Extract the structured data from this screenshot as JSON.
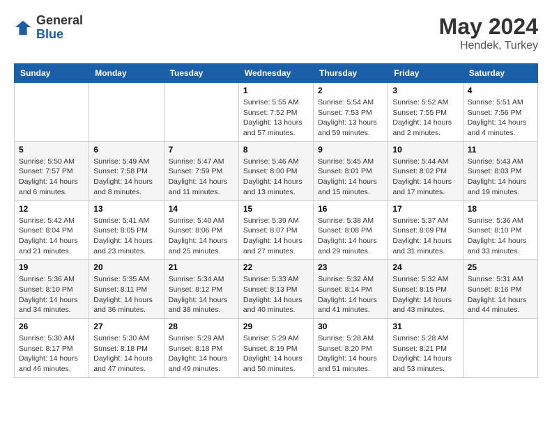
{
  "logo": {
    "general": "General",
    "blue": "Blue"
  },
  "title": {
    "month_year": "May 2024",
    "location": "Hendek, Turkey"
  },
  "days_of_week": [
    "Sunday",
    "Monday",
    "Tuesday",
    "Wednesday",
    "Thursday",
    "Friday",
    "Saturday"
  ],
  "weeks": [
    [
      {
        "day": "",
        "info": ""
      },
      {
        "day": "",
        "info": ""
      },
      {
        "day": "",
        "info": ""
      },
      {
        "day": "1",
        "info": "Sunrise: 5:55 AM\nSunset: 7:52 PM\nDaylight: 13 hours\nand 57 minutes."
      },
      {
        "day": "2",
        "info": "Sunrise: 5:54 AM\nSunset: 7:53 PM\nDaylight: 13 hours\nand 59 minutes."
      },
      {
        "day": "3",
        "info": "Sunrise: 5:52 AM\nSunset: 7:55 PM\nDaylight: 14 hours\nand 2 minutes."
      },
      {
        "day": "4",
        "info": "Sunrise: 5:51 AM\nSunset: 7:56 PM\nDaylight: 14 hours\nand 4 minutes."
      }
    ],
    [
      {
        "day": "5",
        "info": "Sunrise: 5:50 AM\nSunset: 7:57 PM\nDaylight: 14 hours\nand 6 minutes."
      },
      {
        "day": "6",
        "info": "Sunrise: 5:49 AM\nSunset: 7:58 PM\nDaylight: 14 hours\nand 8 minutes."
      },
      {
        "day": "7",
        "info": "Sunrise: 5:47 AM\nSunset: 7:59 PM\nDaylight: 14 hours\nand 11 minutes."
      },
      {
        "day": "8",
        "info": "Sunrise: 5:46 AM\nSunset: 8:00 PM\nDaylight: 14 hours\nand 13 minutes."
      },
      {
        "day": "9",
        "info": "Sunrise: 5:45 AM\nSunset: 8:01 PM\nDaylight: 14 hours\nand 15 minutes."
      },
      {
        "day": "10",
        "info": "Sunrise: 5:44 AM\nSunset: 8:02 PM\nDaylight: 14 hours\nand 17 minutes."
      },
      {
        "day": "11",
        "info": "Sunrise: 5:43 AM\nSunset: 8:03 PM\nDaylight: 14 hours\nand 19 minutes."
      }
    ],
    [
      {
        "day": "12",
        "info": "Sunrise: 5:42 AM\nSunset: 8:04 PM\nDaylight: 14 hours\nand 21 minutes."
      },
      {
        "day": "13",
        "info": "Sunrise: 5:41 AM\nSunset: 8:05 PM\nDaylight: 14 hours\nand 23 minutes."
      },
      {
        "day": "14",
        "info": "Sunrise: 5:40 AM\nSunset: 8:06 PM\nDaylight: 14 hours\nand 25 minutes."
      },
      {
        "day": "15",
        "info": "Sunrise: 5:39 AM\nSunset: 8:07 PM\nDaylight: 14 hours\nand 27 minutes."
      },
      {
        "day": "16",
        "info": "Sunrise: 5:38 AM\nSunset: 8:08 PM\nDaylight: 14 hours\nand 29 minutes."
      },
      {
        "day": "17",
        "info": "Sunrise: 5:37 AM\nSunset: 8:09 PM\nDaylight: 14 hours\nand 31 minutes."
      },
      {
        "day": "18",
        "info": "Sunrise: 5:36 AM\nSunset: 8:10 PM\nDaylight: 14 hours\nand 33 minutes."
      }
    ],
    [
      {
        "day": "19",
        "info": "Sunrise: 5:36 AM\nSunset: 8:10 PM\nDaylight: 14 hours\nand 34 minutes."
      },
      {
        "day": "20",
        "info": "Sunrise: 5:35 AM\nSunset: 8:11 PM\nDaylight: 14 hours\nand 36 minutes."
      },
      {
        "day": "21",
        "info": "Sunrise: 5:34 AM\nSunset: 8:12 PM\nDaylight: 14 hours\nand 38 minutes."
      },
      {
        "day": "22",
        "info": "Sunrise: 5:33 AM\nSunset: 8:13 PM\nDaylight: 14 hours\nand 40 minutes."
      },
      {
        "day": "23",
        "info": "Sunrise: 5:32 AM\nSunset: 8:14 PM\nDaylight: 14 hours\nand 41 minutes."
      },
      {
        "day": "24",
        "info": "Sunrise: 5:32 AM\nSunset: 8:15 PM\nDaylight: 14 hours\nand 43 minutes."
      },
      {
        "day": "25",
        "info": "Sunrise: 5:31 AM\nSunset: 8:16 PM\nDaylight: 14 hours\nand 44 minutes."
      }
    ],
    [
      {
        "day": "26",
        "info": "Sunrise: 5:30 AM\nSunset: 8:17 PM\nDaylight: 14 hours\nand 46 minutes."
      },
      {
        "day": "27",
        "info": "Sunrise: 5:30 AM\nSunset: 8:18 PM\nDaylight: 14 hours\nand 47 minutes."
      },
      {
        "day": "28",
        "info": "Sunrise: 5:29 AM\nSunset: 8:18 PM\nDaylight: 14 hours\nand 49 minutes."
      },
      {
        "day": "29",
        "info": "Sunrise: 5:29 AM\nSunset: 8:19 PM\nDaylight: 14 hours\nand 50 minutes."
      },
      {
        "day": "30",
        "info": "Sunrise: 5:28 AM\nSunset: 8:20 PM\nDaylight: 14 hours\nand 51 minutes."
      },
      {
        "day": "31",
        "info": "Sunrise: 5:28 AM\nSunset: 8:21 PM\nDaylight: 14 hours\nand 53 minutes."
      },
      {
        "day": "",
        "info": ""
      }
    ]
  ]
}
